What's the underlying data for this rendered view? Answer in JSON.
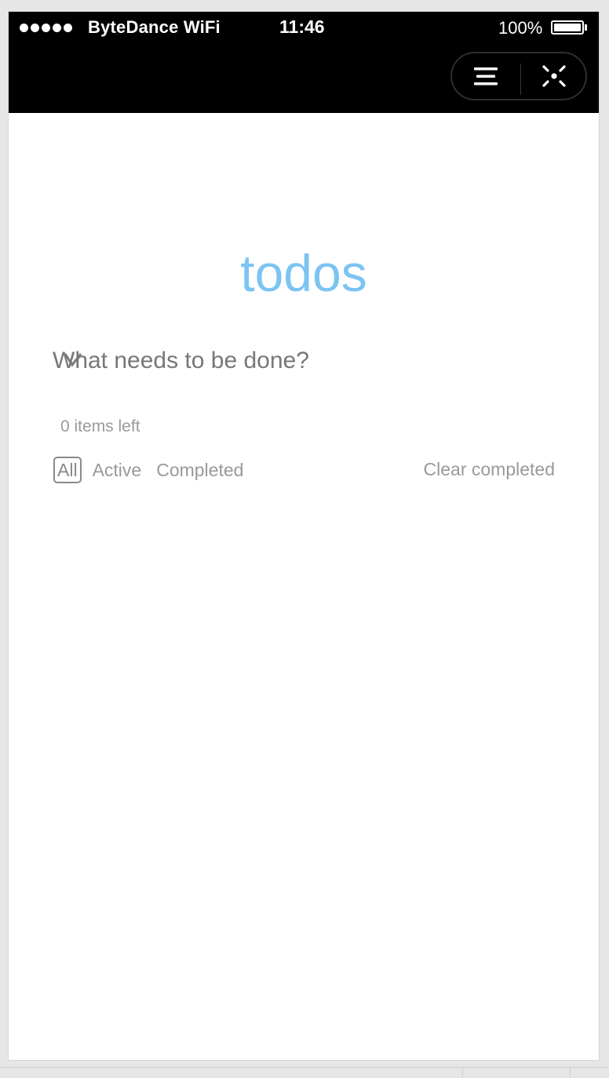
{
  "status_bar": {
    "carrier": "ByteDance WiFi",
    "time": "11:46",
    "battery": "100%",
    "signal_bars": 5
  },
  "nav_capsule": {
    "menu_icon": "menu-icon",
    "close_icon": "close-circle-icon"
  },
  "todo": {
    "title": "todos",
    "input_placeholder": "What needs to be done?",
    "items_left": "0 items left",
    "filters": [
      "All",
      "Active",
      "Completed"
    ],
    "selected_filter": "All",
    "clear_label": "Clear completed"
  },
  "colors": {
    "title_color": "#7cc4f2",
    "status_bar_bg": "#000000",
    "text_muted": "#999999"
  }
}
